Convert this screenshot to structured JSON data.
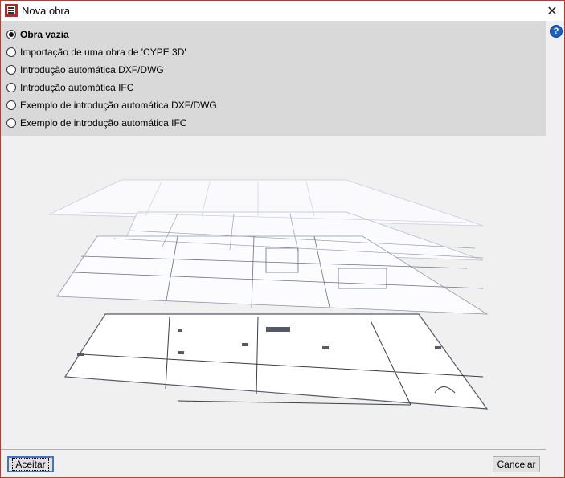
{
  "window": {
    "title": "Nova obra",
    "close_glyph": "✕",
    "help_glyph": "?"
  },
  "options": [
    {
      "label": "Obra vazia",
      "selected": true
    },
    {
      "label": "Importação de uma obra de 'CYPE 3D'",
      "selected": false
    },
    {
      "label": "Introdução automática DXF/DWG",
      "selected": false
    },
    {
      "label": "Introdução automática IFC",
      "selected": false
    },
    {
      "label": "Exemplo de introdução automática DXF/DWG",
      "selected": false
    },
    {
      "label": "Exemplo de introdução automática IFC",
      "selected": false
    }
  ],
  "buttons": {
    "ok_label": "Aceitar",
    "cancel_label": "Cancelar"
  },
  "icons": {
    "app": "cype-app-icon",
    "close": "close-icon",
    "help": "help-icon"
  },
  "colors": {
    "accent": "#3b78c4",
    "window_border": "#c0392b",
    "panel": "#d9d9d9"
  }
}
